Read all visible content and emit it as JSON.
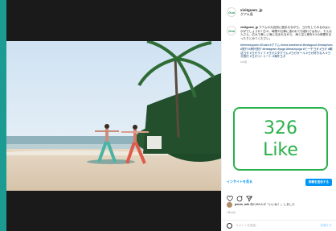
{
  "account": {
    "username": "visitguam_jp",
    "location": "グアム島",
    "avatar_text": "Gua"
  },
  "caption": {
    "username": "visitguam_jp",
    "text": "グアムの大自然に囲まれながら、ヨガをしてみるのはいかがでしょうか? 日々、時間や仕事に追われてお疲れではない、そんな人さえ、広大で美しい海に包まれながら、海と空と緑を5つの時間をまったりとみてください。",
    "hashtags": "#hereweguam #Guam #グアム #mea #weekend #instagood #instaphoto #旅行 #海外旅行 #instagram #yoga #beachyoga #ビーチヨガ #ヨガ #朝活ヨガ #ヨガライフ #ヨガスタグラム #ヨガガール #ヨガ好きな人 #ヨガ旅行 #ヨガリトリート #海外ヨガ",
    "age": "106週"
  },
  "like_overlay": {
    "count": "326",
    "label": "Like"
  },
  "insights": {
    "link": "インサイトを見る",
    "boost": "投稿を宣伝する"
  },
  "likes": {
    "user": "poros_mik",
    "text": "他2,654人が「いいね！」しました"
  },
  "date": "7月16日",
  "comment": {
    "placeholder": "コメントを追加...",
    "post": "投稿する"
  }
}
